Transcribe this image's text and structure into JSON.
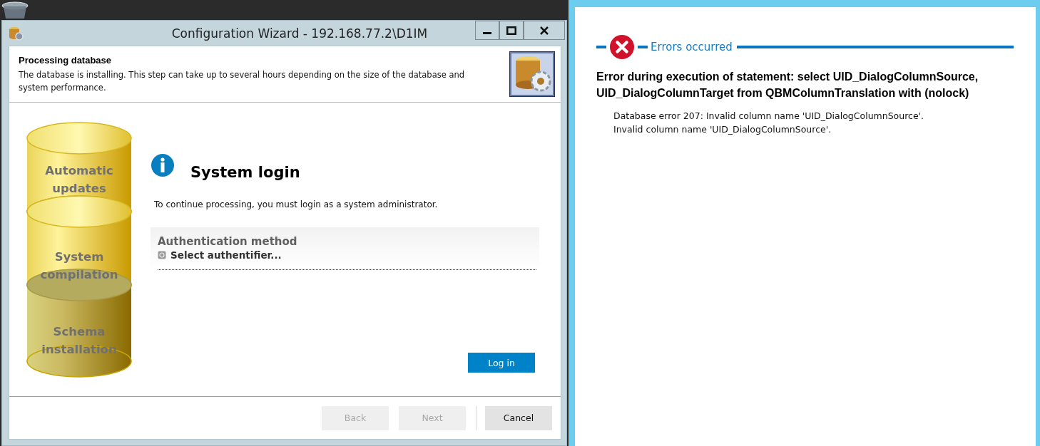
{
  "window": {
    "title": "Configuration Wizard - 192.168.77.2\\D1IM"
  },
  "header": {
    "title": "Processing database",
    "description": "The database is installing.  This step can take up to several hours depending on the size of the database and system performance."
  },
  "stages": [
    {
      "label": "Automatic updates",
      "active": false
    },
    {
      "label": "System compilation",
      "active": false
    },
    {
      "label": "Schema installation",
      "active": true
    }
  ],
  "login": {
    "title": "System login",
    "message": "To continue processing, you must login as a system administrator.",
    "auth_heading": "Authentication method",
    "auth_option": "Select authentifier...",
    "button": "Log in"
  },
  "footer_buttons": [
    {
      "label": "Back",
      "disabled": true
    },
    {
      "label": "Next",
      "disabled": true
    },
    {
      "label": "Cancel",
      "disabled": false
    }
  ],
  "error_panel": {
    "heading": "Errors occurred",
    "message": "Error during execution of statement: select UID_DialogColumnSource, UID_DialogColumnTarget from QBMColumnTranslation with (nolock)",
    "details": [
      "Database error 207: Invalid column name 'UID_DialogColumnSource'.",
      "Invalid column name 'UID_DialogColumnSource'."
    ]
  }
}
